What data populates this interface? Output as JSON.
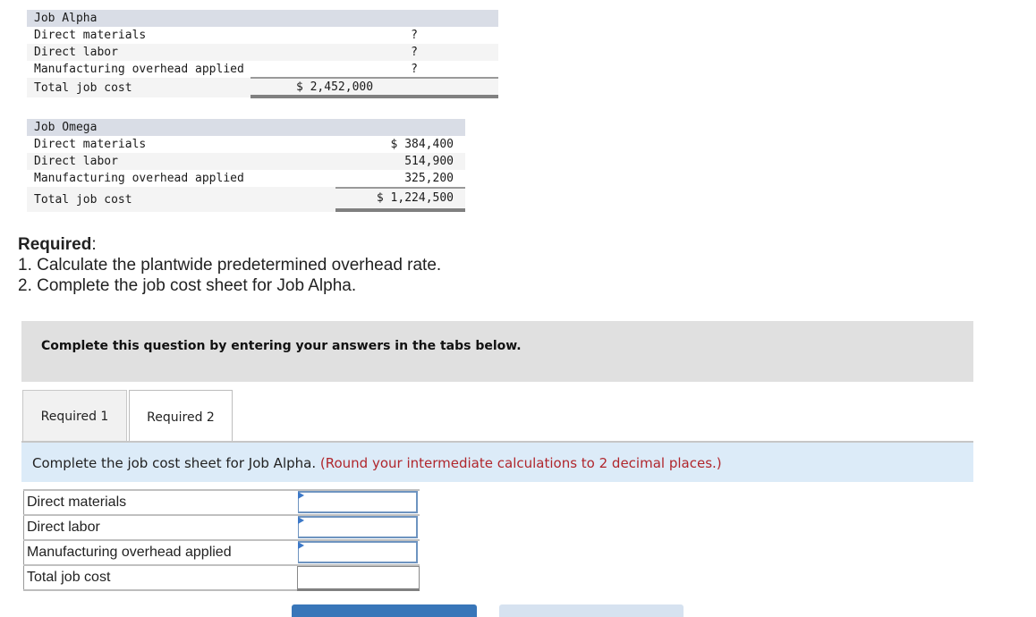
{
  "job_alpha": {
    "title": "Job Alpha",
    "rows": [
      {
        "label": "Direct materials",
        "value": "?"
      },
      {
        "label": "Direct labor",
        "value": "?"
      },
      {
        "label": "Manufacturing overhead applied",
        "value": "?"
      }
    ],
    "total": {
      "label": "Total job cost",
      "value": "$ 2,452,000"
    }
  },
  "job_omega": {
    "title": "Job Omega",
    "rows": [
      {
        "label": "Direct materials",
        "value": "$ 384,400"
      },
      {
        "label": "Direct labor",
        "value": "514,900"
      },
      {
        "label": "Manufacturing overhead applied",
        "value": "325,200"
      }
    ],
    "total": {
      "label": "Total job cost",
      "value": "$ 1,224,500"
    }
  },
  "required": {
    "title": "Required",
    "colon": ":",
    "items": [
      "1. Calculate the plantwide predetermined overhead rate.",
      "2. Complete the job cost sheet for Job Alpha."
    ]
  },
  "banner": {
    "text": "Complete this question by entering your answers in the tabs below."
  },
  "tabs": [
    {
      "label": "Required 1",
      "active": false
    },
    {
      "label": "Required 2",
      "active": true
    }
  ],
  "instructions": {
    "text": "Complete the job cost sheet for Job Alpha.",
    "note": "(Round your intermediate calculations to 2 decimal places.)",
    "note_color": "#b0262c"
  },
  "answer_table": {
    "rows": [
      {
        "label": "Direct materials",
        "value": "",
        "editable": true
      },
      {
        "label": "Direct labor",
        "value": "",
        "editable": true
      },
      {
        "label": "Manufacturing overhead applied",
        "value": "",
        "editable": true
      }
    ],
    "total": {
      "label": "Total job cost",
      "value": ""
    }
  },
  "colors": {
    "accent": "#3876b9",
    "header_row": "#d9dde6",
    "banner_bg": "#e0e0e0",
    "instructions_bg": "#dcebf8"
  }
}
